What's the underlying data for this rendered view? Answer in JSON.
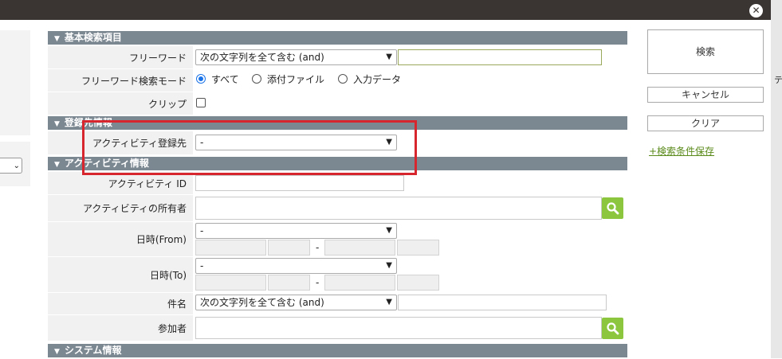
{
  "colors": {
    "accent_green": "#8cc63f",
    "section_header": "#7b8791",
    "highlight_red": "#d8262f",
    "radio_blue": "#1a73e8"
  },
  "close_icon": "✕",
  "right_edge_fragment": "テ",
  "sections": {
    "basic": "基本検索項目",
    "registration": "登録先情報",
    "activity": "アクティビティ情報",
    "system": "システム情報"
  },
  "fields": {
    "freeword": {
      "label": "フリーワード",
      "select_value": "次の文字列を全て含む (and)",
      "input_value": ""
    },
    "freeword_mode": {
      "label": "フリーワード検索モード",
      "options": [
        "すべて",
        "添付ファイル",
        "入力データ"
      ],
      "selected": "すべて"
    },
    "clip": {
      "label": "クリップ",
      "checked": false
    },
    "activity_target": {
      "label": "アクティビティ登録先",
      "select_value": "-"
    },
    "activity_id": {
      "label": "アクティビティ ID",
      "value": ""
    },
    "activity_owner": {
      "label": "アクティビティの所有者",
      "value": ""
    },
    "date_from": {
      "label": "日時(From)",
      "select_value": "-",
      "separator": "-"
    },
    "date_to": {
      "label": "日時(To)",
      "select_value": "-",
      "separator": "-"
    },
    "subject": {
      "label": "件名",
      "select_value": "次の文字列を全て含む (and)",
      "input_value": ""
    },
    "participants": {
      "label": "参加者",
      "value": ""
    }
  },
  "buttons": {
    "search": "検索",
    "cancel": "キャンセル",
    "clear": "クリア",
    "save_conditions": "+検索条件保存"
  },
  "icons": {
    "section_toggle": "chevron-down-icon",
    "lookup": "search-icon"
  }
}
